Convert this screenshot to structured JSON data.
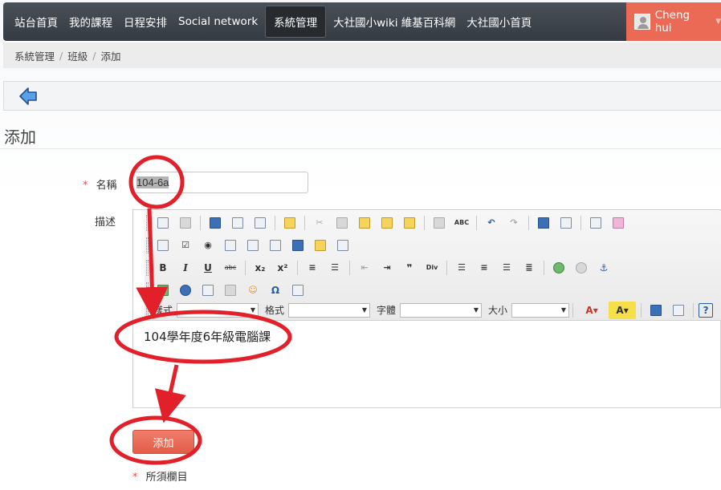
{
  "nav": {
    "items": [
      {
        "label": "站台首頁"
      },
      {
        "label": "我的課程"
      },
      {
        "label": "日程安排"
      },
      {
        "label": "Social network"
      },
      {
        "label": "系統管理",
        "active": true
      },
      {
        "label": "大社國小wiki 維基百科網"
      },
      {
        "label": "大社國小首頁"
      }
    ],
    "user_name": "Cheng hui"
  },
  "breadcrumb": [
    "系統管理",
    "班級",
    "添加"
  ],
  "page_title": "添加",
  "form": {
    "required_mark": "*",
    "name_label": "名稱",
    "name_value": "104-6a",
    "desc_label": "描述",
    "editor": {
      "style_label": "樣式",
      "format_label": "格式",
      "font_label": "字體",
      "size_label": "大小",
      "content": "104學年度6年級電腦課"
    },
    "submit_label": "添加",
    "required_note": "所須欄目"
  },
  "colors": {
    "nav_bg": "#3f454c",
    "user_menu_bg": "#ea6a55",
    "submit_bg": "#e8674f",
    "annotation_red": "#e2202a"
  }
}
